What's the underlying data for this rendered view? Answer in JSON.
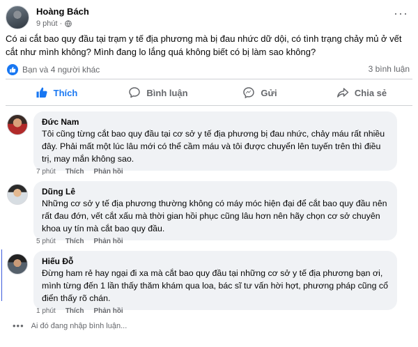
{
  "post": {
    "author": "Hoàng Bách",
    "time": "9 phút ·",
    "more_label": "···",
    "text": "Có ai cắt bao quy đầu tại trạm y tế địa phương mà bị đau nhức dữ dội, có tình trạng chảy mủ ở vết cắt như mình không? Mình đang lo lắng quá không biết có bị làm sao không?",
    "reactions_text": "Bạn và 4 người khác",
    "comments_count": "3 bình luận"
  },
  "actions": {
    "like": "Thích",
    "comment": "Bình luận",
    "send": "Gửi",
    "share": "Chia sẻ"
  },
  "comments": [
    {
      "name": "Đức Nam",
      "text": "Tôi cũng từng cắt bao quy đầu tại cơ sở y tế địa phương bị đau nhức, chảy máu rất nhiều đây. Phải mất một lúc lâu mới có thể cầm máu và tôi được chuyển lên tuyến trên thì điều trị, may mắn không sao.",
      "time": "7 phút",
      "like": "Thích",
      "reply": "Phản hồi"
    },
    {
      "name": "Dũng Lê",
      "text": "Những cơ sở y tế địa phương thường không có máy móc hiện đại để cắt bao quy đầu nên rất đau đớn, vết cắt xấu mà thời gian hồi phục cũng lâu hơn nên hãy chọn cơ sở chuyên khoa uy tín mà cắt bao quy đầu.",
      "time": "5 phút",
      "like": "Thích",
      "reply": "Phản hồi"
    },
    {
      "name": "Hiếu Đỗ",
      "text": "Đừng ham rẻ hay ngại đi xa mà cắt bao quy đầu tại những cơ sở y tế địa phương bạn ơi, mình từng đến 1 lần thấy thăm khám qua loa, bác sĩ tư vấn hời hợt, phương pháp cũng cổ điển thấy rõ chán.",
      "time": "1 phút",
      "like": "Thích",
      "reply": "Phản hồi"
    }
  ],
  "typing_text": "Ai đó đang nhập bình luận...",
  "colors": {
    "accent": "#1877f2",
    "muted": "#65676b",
    "bubble": "#f0f2f5"
  },
  "icons": [
    "globe-icon",
    "like-thumb-icon",
    "comment-icon",
    "send-icon",
    "share-icon",
    "more-icon",
    "typing-dots-icon"
  ]
}
